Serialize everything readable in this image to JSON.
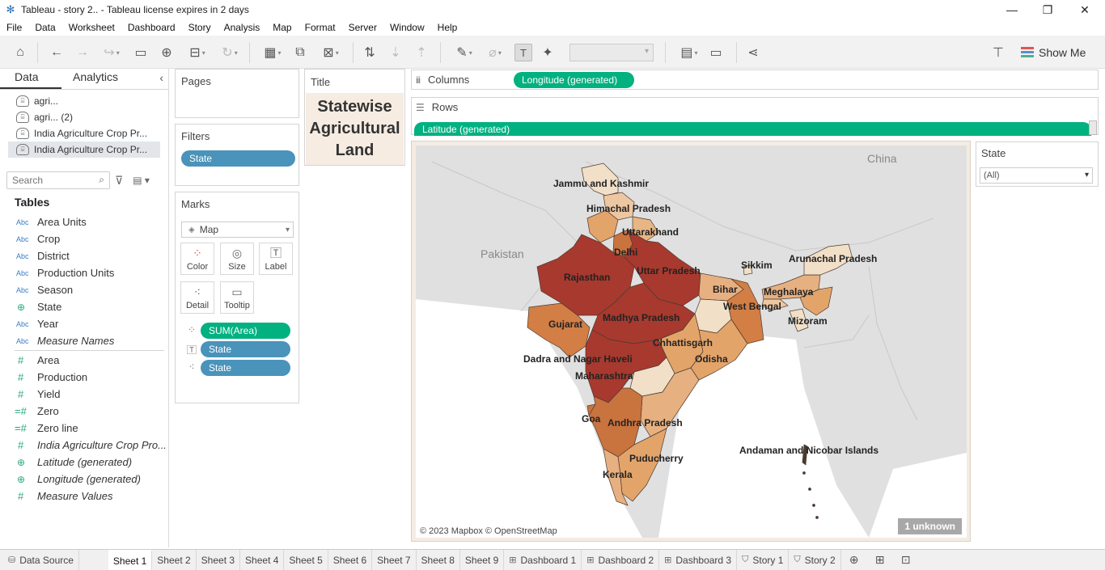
{
  "window": {
    "title": "Tableau - story 2.. - Tableau license expires in 2 days"
  },
  "menu": [
    "File",
    "Data",
    "Worksheet",
    "Dashboard",
    "Story",
    "Analysis",
    "Map",
    "Format",
    "Server",
    "Window",
    "Help"
  ],
  "toolbar": {
    "show_me": "Show Me"
  },
  "data_pane": {
    "tabs": {
      "data": "Data",
      "analytics": "Analytics"
    },
    "sources": [
      "agri...",
      "agri... (2)",
      "India Agriculture Crop Pr...",
      "India Agriculture Crop Pr..."
    ],
    "search_placeholder": "Search",
    "tables_label": "Tables",
    "dimensions": [
      {
        "type": "Abc",
        "label": "Area Units"
      },
      {
        "type": "Abc",
        "label": "Crop"
      },
      {
        "type": "Abc",
        "label": "District"
      },
      {
        "type": "Abc",
        "label": "Production Units"
      },
      {
        "type": "Abc",
        "label": "Season"
      },
      {
        "type": "geo",
        "label": "State"
      },
      {
        "type": "Abc",
        "label": "Year"
      },
      {
        "type": "Abc",
        "label": "Measure Names"
      }
    ],
    "measures": [
      {
        "type": "#",
        "label": "Area"
      },
      {
        "type": "#",
        "label": "Production"
      },
      {
        "type": "#",
        "label": "Yield"
      },
      {
        "type": "=#",
        "label": "Zero"
      },
      {
        "type": "=#",
        "label": "Zero line"
      },
      {
        "type": "#",
        "label": "India Agriculture Crop Pro..."
      },
      {
        "type": "geo",
        "label": "Latitude (generated)"
      },
      {
        "type": "geo",
        "label": "Longitude (generated)"
      },
      {
        "type": "#",
        "label": "Measure Values"
      }
    ]
  },
  "cards": {
    "pages": "Pages",
    "filters": "Filters",
    "filter_pill": "State",
    "marks": "Marks",
    "mark_type": "Map",
    "mark_buttons": {
      "color": "Color",
      "size": "Size",
      "label": "Label",
      "detail": "Detail",
      "tooltip": "Tooltip"
    },
    "mark_fields": {
      "color": "SUM(Area)",
      "label": "State",
      "detail": "State"
    }
  },
  "title_card": {
    "label": "Title",
    "text": "Statewise\nAgricultural\nLand"
  },
  "shelves": {
    "columns_label": "Columns",
    "columns_pill": "Longitude (generated)",
    "rows_label": "Rows",
    "rows_pill": "Latitude (generated)"
  },
  "state_filter": {
    "title": "State",
    "value": "(All)"
  },
  "map": {
    "countries": {
      "china": "China",
      "pakistan": "Pakistan"
    },
    "state_labels": {
      "jammu_kashmir": "Jammu and Kashmir",
      "himachal": "Himachal Pradesh",
      "uttarakhand": "Uttarakhand",
      "delhi": "Delhi",
      "uttar_pradesh": "Uttar Pradesh",
      "rajasthan": "Rajasthan",
      "sikkim": "Sikkim",
      "arunachal": "Arunachal Pradesh",
      "bihar": "Bihar",
      "meghalaya": "Meghalaya",
      "west_bengal": "West Bengal",
      "mizoram": "Mizoram",
      "gujarat": "Gujarat",
      "madhya_pradesh": "Madhya Pradesh",
      "chhattisgarh": "Chhattisgarh",
      "odisha": "Odisha",
      "dadra": "Dadra and Nagar Haveli",
      "maharashtra": "Maharashtra",
      "goa": "Goa",
      "andhra": "Andhra Pradesh",
      "andaman": "Andaman and Nicobar Islands",
      "puducherry": "Puducherry",
      "kerala": "Kerala"
    },
    "attribution": "© 2023 Mapbox © OpenStreetMap",
    "unknown": "1 unknown",
    "colors": {
      "low": "#f2dfc8",
      "mid": "#e3a46a",
      "high": "#a8392e",
      "water": "#ffffff",
      "land": "#e0e0e0"
    }
  },
  "bottom_tabs": {
    "data_source": "Data Source",
    "sheets": [
      "Sheet 1",
      "Sheet 2",
      "Sheet 3",
      "Sheet 4",
      "Sheet 5",
      "Sheet 6",
      "Sheet 7",
      "Sheet 8",
      "Sheet 9"
    ],
    "dashboards": [
      "Dashboard 1",
      "Dashboard 2",
      "Dashboard 3"
    ],
    "stories": [
      "Story 1",
      "Story 2"
    ]
  }
}
